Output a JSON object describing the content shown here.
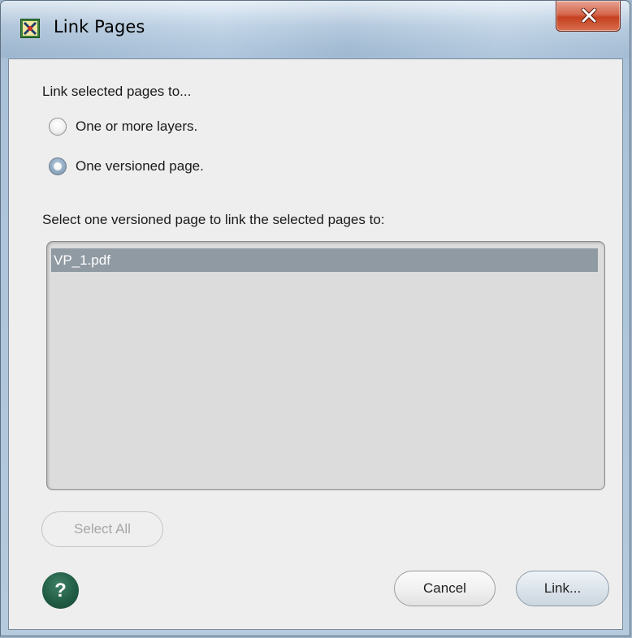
{
  "window": {
    "title": "Link Pages",
    "close_glyph": "x"
  },
  "dialog": {
    "intro_label": "Link selected pages to...",
    "options": [
      {
        "label": "One or more layers.",
        "selected": false
      },
      {
        "label": "One versioned page.",
        "selected": true
      }
    ],
    "list_label": "Select one versioned page to link the selected pages to:",
    "list_items": [
      {
        "label": "VP_1.pdf",
        "selected": true
      }
    ]
  },
  "buttons": {
    "select_all": "Select All",
    "help": "?",
    "cancel": "Cancel",
    "link": "Link..."
  },
  "colors": {
    "selection": "#909aa3",
    "help_button": "#1f5a43",
    "close_button": "#c5401f"
  }
}
